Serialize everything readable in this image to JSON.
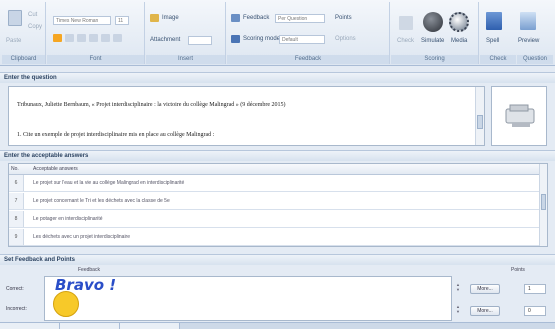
{
  "ribbon": {
    "groups": [
      "Clipboard",
      "Font",
      "Insert",
      "Feedback",
      "Scoring",
      "Check",
      "Question"
    ],
    "clipboard": {
      "cut": "Cut",
      "copy": "Copy",
      "paste": "Paste"
    },
    "font": {
      "name": "Times New Roman",
      "size": "11"
    },
    "insert": {
      "item1": "Image",
      "item2": "Attachment"
    },
    "feedback": {
      "label1": "Feedback",
      "value1": "Per Question",
      "label2": "Scoring mode",
      "value2": "Default",
      "points_label": "Points",
      "options_label": "Options"
    },
    "scoring": {
      "btn1": "Check",
      "btn2": "Simulate",
      "btn3": "Media"
    },
    "check": {
      "btn1": "Spell",
      "btn2": "Preview"
    }
  },
  "question": {
    "section_title": "Enter the question",
    "line1": "Tribunaux, Juliette Bernbaum, « Projet interdisciplinaire : la victoire du collège Malingrad » (9 décembre 2015)",
    "line2": "1. Cite un exemple de projet interdisciplinaire mis en place au collège Malingrad :"
  },
  "answers": {
    "section_title": "Enter the acceptable answers",
    "col_no": "No.",
    "col_answer": "Acceptable answers",
    "rows": [
      {
        "num": "6",
        "text": "Le projet sur l'eau et la vie au collège Malingrad en interdisciplinarité"
      },
      {
        "num": "7",
        "text": "Le projet concernant le Tri et les déchets avec la classe de 5e"
      },
      {
        "num": "8",
        "text": "Le potager en interdisciplinarité"
      },
      {
        "num": "9",
        "text": "Les déchets avec un projet interdisciplinaire"
      }
    ]
  },
  "feedback_panel": {
    "section_title": "Set Feedback and Points",
    "col_feedback": "Feedback",
    "col_points": "Points",
    "correct_label": "Correct:",
    "incorrect_label": "Incorrect:",
    "correct_text": "Bravo !",
    "more_label": "More...",
    "correct_points": "1",
    "incorrect_points": "0"
  }
}
